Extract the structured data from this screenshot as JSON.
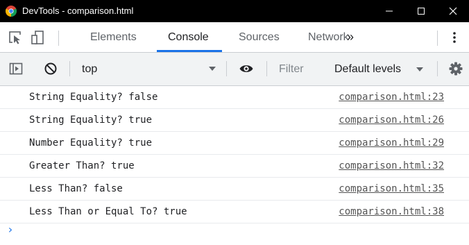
{
  "window": {
    "title": "DevTools - comparison.html",
    "icon": "chrome-logo-icon",
    "controls": [
      "minimize-icon",
      "maximize-icon",
      "close-icon"
    ]
  },
  "main_toolbar": {
    "icons": [
      "inspect-element-icon",
      "device-toggle-icon"
    ],
    "tabs": [
      {
        "label": "Elements",
        "active": false
      },
      {
        "label": "Console",
        "active": true
      },
      {
        "label": "Sources",
        "active": false
      },
      {
        "label": "Network",
        "active": false
      }
    ],
    "more_tabs": "»",
    "accent": "#1a73e8"
  },
  "console_toolbar": {
    "icons": [
      "sidebar-toggle-icon",
      "clear-console-icon",
      "eye-icon",
      "settings-gear-icon"
    ],
    "context": "top",
    "filter_placeholder": "Filter",
    "levels_label": "Default levels"
  },
  "messages": [
    {
      "text": "String Equality? false",
      "source": "comparison.html:23"
    },
    {
      "text": "String Equality? true",
      "source": "comparison.html:26"
    },
    {
      "text": "Number Equality? true",
      "source": "comparison.html:29"
    },
    {
      "text": "Greater Than? true",
      "source": "comparison.html:32"
    },
    {
      "text": "Less Than? false",
      "source": "comparison.html:35"
    },
    {
      "text": "Less Than or Equal To? true",
      "source": "comparison.html:38"
    }
  ],
  "prompt": {
    "caret": "›"
  }
}
